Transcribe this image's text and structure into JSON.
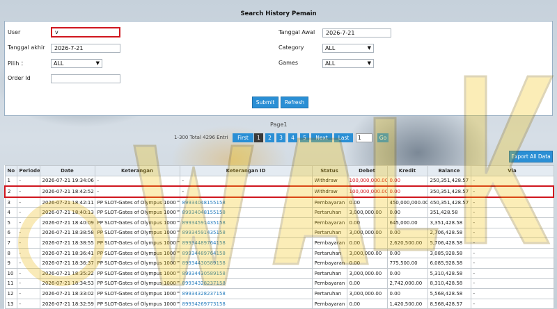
{
  "page_title": "Search History Pemain",
  "form": {
    "user_label": "User",
    "user_value": "v",
    "tanggal_akhir_label": "Tanggal akhir",
    "tanggal_akhir_value": "2026-7-21",
    "pilih_label": "Pilih ：",
    "pilih_value": "ALL",
    "order_id_label": "Order Id",
    "order_id_value": "",
    "tanggal_awal_label": "Tanggal Awal",
    "tanggal_awal_value": "2026-7-21",
    "category_label": "Category",
    "category_value": "ALL",
    "games_label": "Games",
    "games_value": "ALL",
    "submit_label": "Submit",
    "refresh_label": "Refresh"
  },
  "pager": {
    "page_label": "Page1",
    "total_label": "1-300 Total 4296 Entri",
    "first": "First",
    "pages": [
      "1",
      "2",
      "3",
      "4",
      "5"
    ],
    "next": "Next",
    "last": "Last",
    "input_value": "1",
    "go": "Go"
  },
  "export_label": "Export All Data",
  "table": {
    "headers": [
      "No",
      "Periode",
      "Date",
      "Keterangan",
      "Keterangan ID",
      "Status",
      "Debet",
      "Kredit",
      "Balance",
      "Via"
    ],
    "rows": [
      {
        "no": "1",
        "periode": "-",
        "date": "2026-07-21 19:34:06",
        "ket": "-",
        "ket_id": "-",
        "status": "Withdraw",
        "debet": "100,000,000.00",
        "kredit": "0.00",
        "balance": "250,351,428.57",
        "via": "-"
      },
      {
        "no": "2",
        "periode": "-",
        "date": "2026-07-21 18:42:52",
        "ket": "-",
        "ket_id": "-",
        "status": "Withdraw",
        "debet": "100,000,000.00",
        "kredit": "0.00",
        "balance": "350,351,428.57",
        "via": "-"
      },
      {
        "no": "3",
        "periode": "-",
        "date": "2026-07-21 18:42:11",
        "ket": "PP SLOT-Gates of Olympus 1000™",
        "ket_id": "89934048155158",
        "status": "Pembayaran",
        "debet": "0.00",
        "kredit": "450,000,000.00",
        "balance": "450,351,428.57",
        "via": "-"
      },
      {
        "no": "4",
        "periode": "-",
        "date": "2026-07-21 18:40:13",
        "ket": "PP SLOT-Gates of Olympus 1000™",
        "ket_id": "89934048155158",
        "status": "Pertaruhan",
        "debet": "3,000,000.00",
        "kredit": "0.00",
        "balance": "351,428.58",
        "via": "-"
      },
      {
        "no": "5",
        "periode": "-",
        "date": "2026-07-21 18:40:09",
        "ket": "PP SLOT-Gates of Olympus 1000™",
        "ket_id": "89934591435158",
        "status": "Pembayaran",
        "debet": "0.00",
        "kredit": "645,000.00",
        "balance": "3,351,428.58",
        "via": "-"
      },
      {
        "no": "6",
        "periode": "-",
        "date": "2026-07-21 18:38:58",
        "ket": "PP SLOT-Gates of Olympus 1000™",
        "ket_id": "89934591435158",
        "status": "Pertaruhan",
        "debet": "3,000,000.00",
        "kredit": "0.00",
        "balance": "2,706,428.58",
        "via": "-"
      },
      {
        "no": "7",
        "periode": "-",
        "date": "2026-07-21 18:38:55",
        "ket": "PP SLOT-Gates of Olympus 1000™",
        "ket_id": "89934489764158",
        "status": "Pembayaran",
        "debet": "0.00",
        "kredit": "2,620,500.00",
        "balance": "5,706,428.58",
        "via": "-"
      },
      {
        "no": "8",
        "periode": "-",
        "date": "2026-07-21 18:36:41",
        "ket": "PP SLOT-Gates of Olympus 1000™",
        "ket_id": "89934489764158",
        "status": "Pertaruhan",
        "debet": "3,000,000.00",
        "kredit": "0.00",
        "balance": "3,085,928.58",
        "via": "-"
      },
      {
        "no": "9",
        "periode": "-",
        "date": "2026-07-21 18:36:37",
        "ket": "PP SLOT-Gates of Olympus 1000™",
        "ket_id": "89934430589158",
        "status": "Pembayaran",
        "debet": "0.00",
        "kredit": "775,500.00",
        "balance": "6,085,928.58",
        "via": "-"
      },
      {
        "no": "10",
        "periode": "-",
        "date": "2026-07-21 18:35:22",
        "ket": "PP SLOT-Gates of Olympus 1000™",
        "ket_id": "89934430589158",
        "status": "Pertaruhan",
        "debet": "3,000,000.00",
        "kredit": "0.00",
        "balance": "5,310,428.58",
        "via": "-"
      },
      {
        "no": "11",
        "periode": "-",
        "date": "2026-07-21 18:34:53",
        "ket": "PP SLOT-Gates of Olympus 1000™",
        "ket_id": "89934328237158",
        "status": "Pembayaran",
        "debet": "0.00",
        "kredit": "2,742,000.00",
        "balance": "8,310,428.58",
        "via": "-"
      },
      {
        "no": "12",
        "periode": "-",
        "date": "2026-07-21 18:33:02",
        "ket": "PP SLOT-Gates of Olympus 1000™",
        "ket_id": "89934328237158",
        "status": "Pertaruhan",
        "debet": "3,000,000.00",
        "kredit": "0.00",
        "balance": "5,568,428.58",
        "via": "-"
      },
      {
        "no": "13",
        "periode": "-",
        "date": "2026-07-21 18:32:59",
        "ket": "PP SLOT-Gates of Olympus 1000™",
        "ket_id": "89934269773158",
        "status": "Pembayaran",
        "debet": "0.00",
        "kredit": "1,420,500.00",
        "balance": "8,568,428.57",
        "via": "-"
      }
    ]
  },
  "watermark_text": "OWAVLIK",
  "colors": {
    "accent": "#2a8fd5",
    "highlight_border": "#d0161e",
    "debit_red": "#d0161e",
    "link_blue": "#2a7fbf"
  }
}
